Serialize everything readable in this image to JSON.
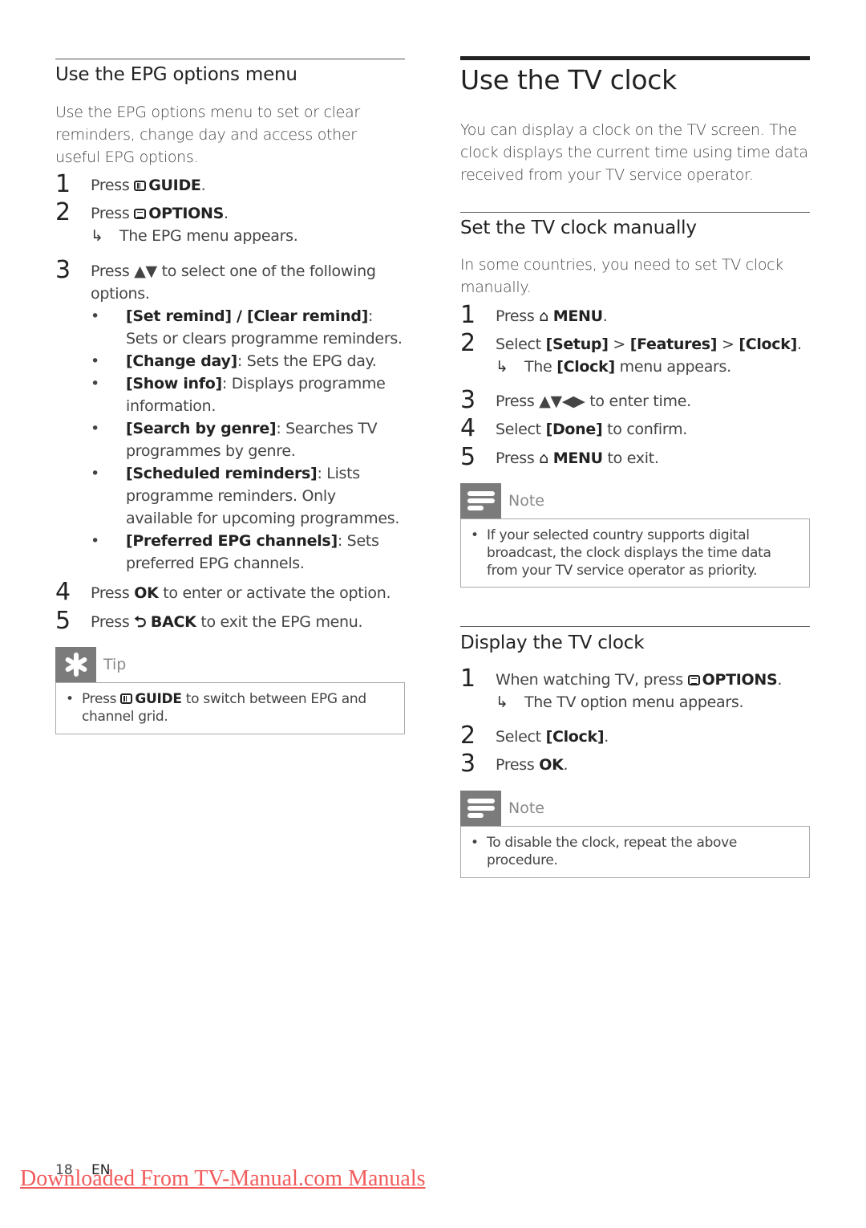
{
  "left": {
    "heading": "Use the EPG options menu",
    "intro": "Use the EPG options menu to set or clear reminders, change day and access other useful EPG options.",
    "steps": [
      {
        "num": "1",
        "pre": "Press ",
        "icon": "guide-icon",
        "key": "GUIDE",
        "post": "."
      },
      {
        "num": "2",
        "pre": "Press ",
        "icon": "options-icon",
        "key": "OPTIONS",
        "post": ".",
        "result": "The EPG menu appears."
      },
      {
        "num": "3",
        "text": "Press ▲▼ to select one of the following options."
      },
      {
        "num": "4",
        "pre": "Press ",
        "key": "OK",
        "post": " to enter or activate the option."
      },
      {
        "num": "5",
        "pre": "Press ",
        "icon": "back-icon",
        "key": "BACK",
        "post": " to exit the EPG menu."
      }
    ],
    "options": [
      {
        "term": "[Set remind] / [Clear remind]",
        "desc": ": Sets or clears programme reminders."
      },
      {
        "term": "[Change day]",
        "desc": ": Sets the EPG day."
      },
      {
        "term": "[Show info]",
        "desc": ": Displays programme information."
      },
      {
        "term": "[Search by genre]",
        "desc": ": Searches TV programmes by genre."
      },
      {
        "term": "[Scheduled reminders]",
        "desc": ": Lists programme reminders. Only available for upcoming programmes."
      },
      {
        "term": "[Preferred EPG channels]",
        "desc": ": Sets preferred EPG channels."
      }
    ],
    "tip": {
      "label": "Tip",
      "pre": "Press ",
      "key": "GUIDE",
      "post": " to switch between EPG and channel grid."
    }
  },
  "right": {
    "title": "Use the TV clock",
    "intro": "You can display a clock on the TV screen. The clock displays the current time using time data received from your TV service operator.",
    "manual": {
      "heading": "Set the TV clock manually",
      "intro": "In some countries, you need to set TV clock manually.",
      "step1_pre": "Press ",
      "step1_key": "MENU",
      "step1_post": ".",
      "step2_pre": "Select ",
      "step2_setup": "[Setup]",
      "step2_sep1": " > ",
      "step2_features": "[Features]",
      "step2_sep2": " > ",
      "step2_clock": "[Clock]",
      "step2_post": ".",
      "step2_result_pre": "The ",
      "step2_result_key": "[Clock]",
      "step2_result_post": " menu appears.",
      "step3": "Press ▲▼◀▶ to enter time.",
      "step4_pre": "Select ",
      "step4_key": "[Done]",
      "step4_post": " to confirm.",
      "step5_pre": "Press ",
      "step5_key": "MENU",
      "step5_post": " to exit.",
      "note_label": "Note",
      "note": "If your selected country supports digital broadcast, the clock displays the time data from your TV service operator as priority."
    },
    "display": {
      "heading": "Display the TV clock",
      "step1_pre": "When watching TV, press ",
      "step1_key": "OPTIONS",
      "step1_post": ".",
      "step1_result": "The TV option menu appears.",
      "step2_pre": "Select ",
      "step2_key": "[Clock]",
      "step2_post": ".",
      "step3_pre": "Press ",
      "step3_key": "OK",
      "step3_post": ".",
      "note_label": "Note",
      "note": "To disable the clock, repeat the above procedure."
    }
  },
  "footer": {
    "page_number": "18",
    "language": "EN",
    "watermark": "Downloaded From TV-Manual.com Manuals"
  }
}
